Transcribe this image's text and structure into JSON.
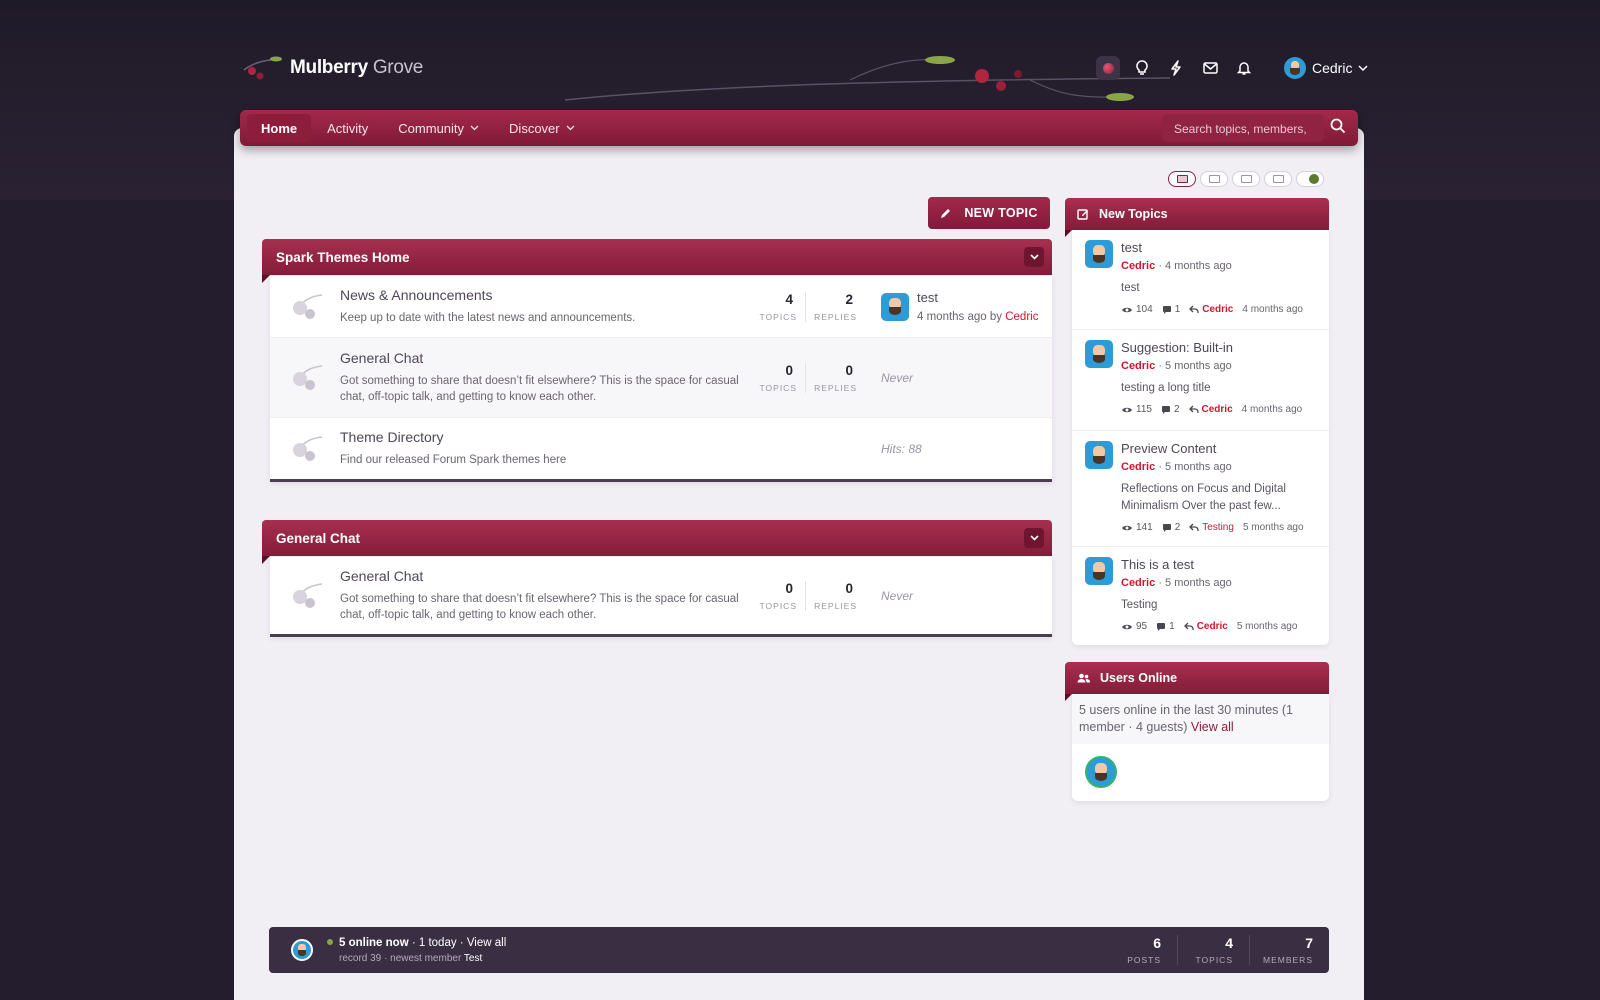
{
  "header": {
    "brand_bold": "Mulberry",
    "brand_light": "Grove",
    "icons": [
      "theme-dot-icon",
      "lightbulb-icon",
      "bolt-icon",
      "mail-icon",
      "bell-icon"
    ],
    "user_name": "Cedric"
  },
  "nav": {
    "items": [
      {
        "label": "Home",
        "active": true
      },
      {
        "label": "Activity"
      },
      {
        "label": "Community",
        "dropdown": true
      },
      {
        "label": "Discover",
        "dropdown": true
      }
    ],
    "search_placeholder": "Search topics, members,"
  },
  "new_topic_label": "NEW TOPIC",
  "categories": [
    {
      "title": "Spark Themes Home",
      "forums": [
        {
          "title": "News & Announcements",
          "desc": "Keep up to date with the latest news and announcements.",
          "topics": "4",
          "replies": "2",
          "last_title": "test",
          "last_meta": "4 months ago by",
          "last_user": "Cedric"
        },
        {
          "title": "General Chat",
          "desc": "Got something to share that doesn’t fit elsewhere? This is the space for casual chat, off-topic talk, and getting to know each other.",
          "topics": "0",
          "replies": "0",
          "last": "Never"
        },
        {
          "title": "Theme Directory",
          "desc": "Find our released Forum Spark themes here",
          "hits": "Hits: 88"
        }
      ]
    },
    {
      "title": "General Chat",
      "forums": [
        {
          "title": "General Chat",
          "desc": "Got something to share that doesn’t fit elsewhere? This is the space for casual chat, off-topic talk, and getting to know each other.",
          "topics": "0",
          "replies": "0",
          "last": "Never"
        }
      ]
    }
  ],
  "stat_labels": {
    "topics": "TOPICS",
    "replies": "REPLIES"
  },
  "new_topics": {
    "title": "New Topics",
    "items": [
      {
        "title": "test",
        "user": "Cedric",
        "time": "4 months ago",
        "excerpt": "test",
        "views": "104",
        "comments": "1",
        "reply_user": "Cedric",
        "reply_time": "4 months ago"
      },
      {
        "title": "Suggestion: Built-in",
        "user": "Cedric",
        "time": "5 months ago",
        "excerpt": "testing a long title",
        "views": "115",
        "comments": "2",
        "reply_user": "Cedric",
        "reply_time": "4 months ago"
      },
      {
        "title": "Preview Content",
        "user": "Cedric",
        "time": "5 months ago",
        "excerpt": "Reflections on Focus and Digital Minimalism Over the past few...",
        "views": "141",
        "comments": "2",
        "reply_user": "Testing",
        "reply_time": "5 months ago"
      },
      {
        "title": "This is a test",
        "user": "Cedric",
        "time": "5 months ago",
        "excerpt": "Testing",
        "views": "95",
        "comments": "1",
        "reply_user": "Cedric",
        "reply_time": "5 months ago"
      }
    ]
  },
  "users_online": {
    "title": "Users Online",
    "text": "5 users online in the last 30 minutes (1 member · 4 guests)",
    "link": "View all"
  },
  "footer": {
    "online_now": "5 online now",
    "today": "· 1 today ·",
    "view_all": "View all",
    "record": "record 39 · newest member",
    "newest": "Test",
    "stats": [
      {
        "value": "6",
        "label": "POSTS"
      },
      {
        "value": "4",
        "label": "TOPICS"
      },
      {
        "value": "7",
        "label": "MEMBERS"
      }
    ]
  },
  "colors": {
    "accent": "#8c1e3c",
    "link_red": "#d4142f",
    "bg": "#241d2d",
    "panel": "#f1eff4"
  }
}
